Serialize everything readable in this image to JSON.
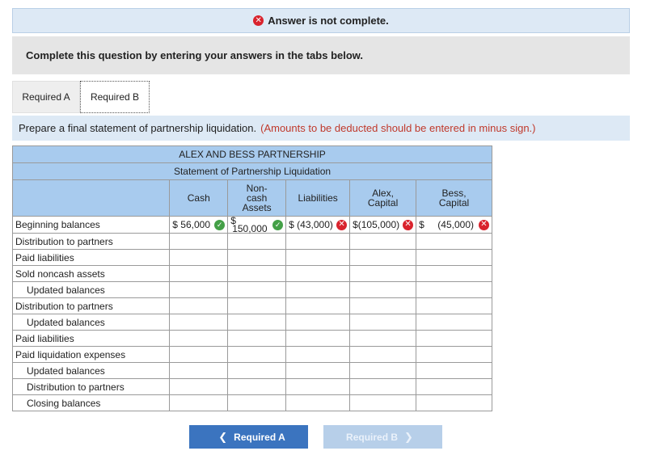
{
  "banner": {
    "text": "Answer is not complete."
  },
  "instruction": "Complete this question by entering your answers in the tabs below.",
  "tabs": [
    {
      "label": "Required A"
    },
    {
      "label": "Required B"
    }
  ],
  "prompt": {
    "text": "Prepare a final statement of partnership liquidation.",
    "note": "(Amounts to be deducted should be entered in minus sign.)"
  },
  "statement": {
    "company": "ALEX AND BESS PARTNERSHIP",
    "title": "Statement of Partnership Liquidation",
    "columns": [
      "Cash",
      "Non-cash Assets",
      "Liabilities",
      "Alex, Capital",
      "Bess, Capital"
    ],
    "beginning": {
      "label": "Beginning balances",
      "cash": "$ 56,000",
      "noncash_prefix": "$",
      "noncash": "150,000",
      "liabilities": "$ (43,000)",
      "alex": "$(105,000)",
      "bess_prefix": "$",
      "bess": "(45,000)"
    },
    "rows": [
      "Distribution to partners",
      "Paid liabilities",
      "Sold noncash assets",
      "Updated balances",
      "Distribution to partners",
      "Updated balances",
      "Paid liabilities",
      "Paid liquidation expenses",
      "Updated balances",
      "Distribution to partners",
      "Closing balances"
    ]
  },
  "nav": {
    "prev": "Required A",
    "next": "Required B"
  },
  "colors": {
    "header_blue": "#a8cbee",
    "banner_blue": "#dde9f5",
    "error_red": "#d9232d",
    "ok_green": "#44a047",
    "button_blue": "#3b74bf"
  }
}
